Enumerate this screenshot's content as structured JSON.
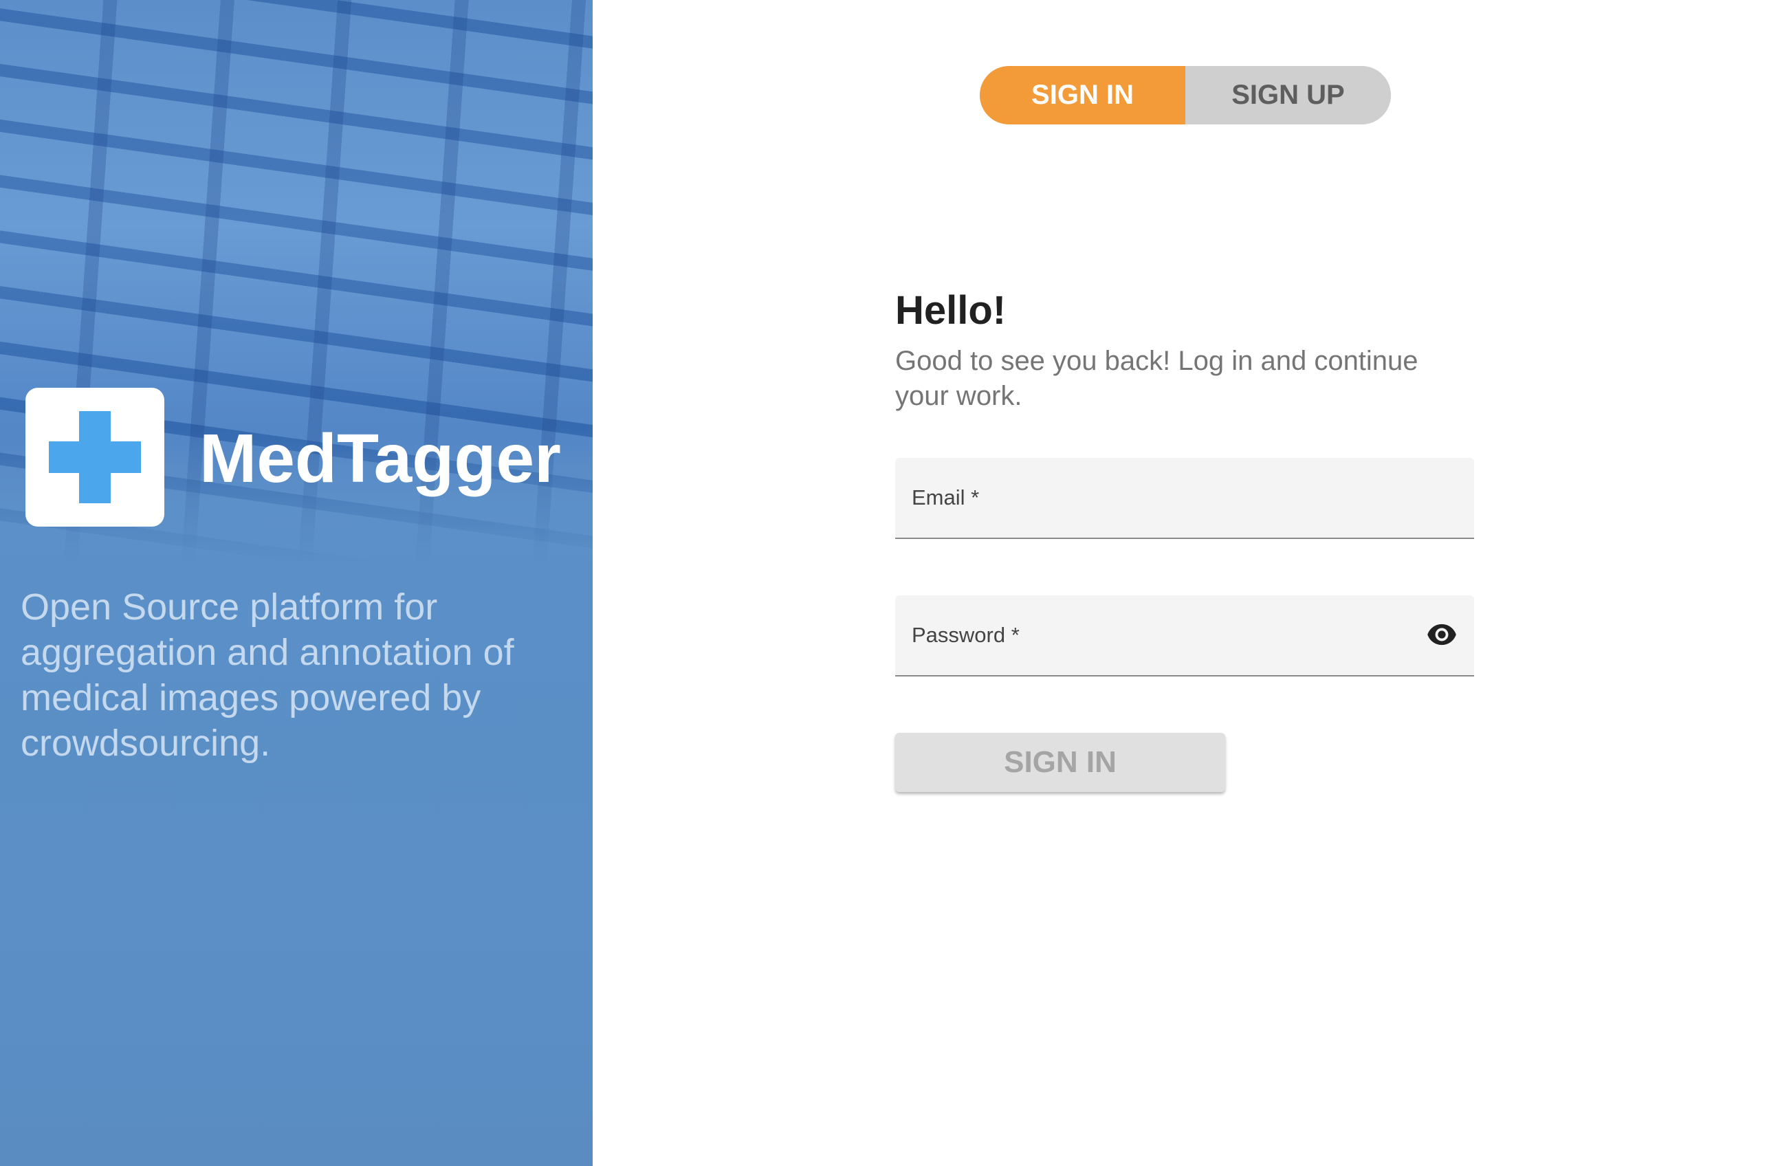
{
  "brand": {
    "name": "MedTagger",
    "tagline": "Open Source platform for aggregation and annotation of medical images powered by crowdsourcing.",
    "logo_icon": "medical-cross-icon",
    "accent_color": "#4ba6ec",
    "panel_color": "#5a8fc7"
  },
  "auth_toggle": {
    "sign_in_label": "SIGN IN",
    "sign_up_label": "SIGN UP",
    "active": "SIGN IN",
    "active_color": "#f29b38"
  },
  "form": {
    "greeting": "Hello!",
    "subtitle": "Good to see you back! Log in and continue your work.",
    "email_label": "Email *",
    "email_value": "",
    "password_label": "Password *",
    "password_value": "",
    "password_toggle_icon": "eye-icon",
    "submit_label": "SIGN IN",
    "submit_disabled": true
  }
}
